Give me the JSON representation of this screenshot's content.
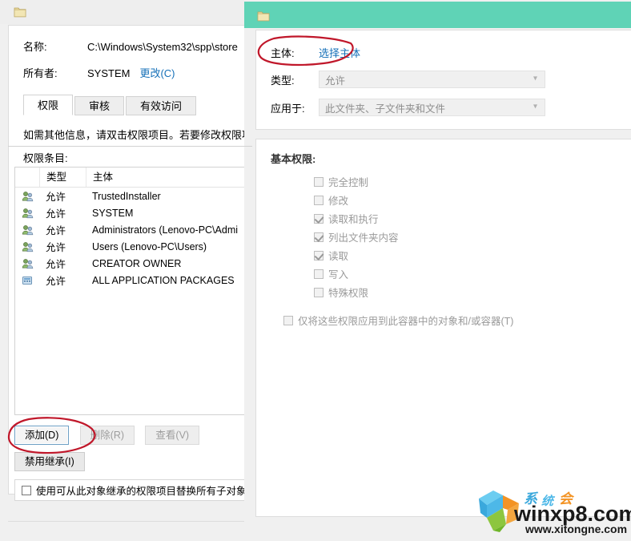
{
  "left_window": {
    "title_icon": "folder-icon",
    "info": {
      "name_label": "名称:",
      "name_value": "C:\\Windows\\System32\\spp\\store",
      "owner_label": "所有者:",
      "owner_value": "SYSTEM",
      "owner_change_link": "更改(C)"
    },
    "tabs": [
      {
        "label": "权限",
        "active": true
      },
      {
        "label": "审核",
        "active": false
      },
      {
        "label": "有效访问",
        "active": false
      }
    ],
    "hint_text": "如需其他信息，请双击权限项目。若要修改权限项",
    "section_label": "权限条目:",
    "table": {
      "columns": [
        "",
        "类型",
        "主体"
      ],
      "rows": [
        {
          "icon": "users-icon",
          "type": "允许",
          "subject": "TrustedInstaller"
        },
        {
          "icon": "users-icon",
          "type": "允许",
          "subject": "SYSTEM"
        },
        {
          "icon": "users-icon",
          "type": "允许",
          "subject": "Administrators (Lenovo-PC\\Admi"
        },
        {
          "icon": "users-icon",
          "type": "允许",
          "subject": "Users (Lenovo-PC\\Users)"
        },
        {
          "icon": "users-icon",
          "type": "允许",
          "subject": "CREATOR OWNER"
        },
        {
          "icon": "app-packages-icon",
          "type": "允许",
          "subject": "ALL APPLICATION PACKAGES"
        }
      ]
    },
    "buttons": {
      "add": "添加(D)",
      "remove": "删除(R)",
      "view": "查看(V)",
      "disable_inheritance": "禁用继承(I)"
    },
    "inherit_checkbox": {
      "label": "使用可从此对象继承的权限项目替换所有子对象",
      "checked": false
    }
  },
  "right_window": {
    "title_icon": "folder-icon",
    "fields": {
      "subject_label": "主体:",
      "subject_link": "选择主体",
      "type_label": "类型:",
      "type_value": "允许",
      "applies_label": "应用于:",
      "applies_value": "此文件夹、子文件夹和文件"
    },
    "basic_permissions_label": "基本权限:",
    "permissions": [
      {
        "label": "完全控制",
        "checked": false
      },
      {
        "label": "修改",
        "checked": false
      },
      {
        "label": "读取和执行",
        "checked": true
      },
      {
        "label": "列出文件夹内容",
        "checked": true
      },
      {
        "label": "读取",
        "checked": true
      },
      {
        "label": "写入",
        "checked": false
      },
      {
        "label": "特殊权限",
        "checked": false
      }
    ],
    "container_only": {
      "label": "仅将这些权限应用到此容器中的对象和/或容器(T)",
      "checked": false
    }
  },
  "annotations": {
    "add_button_circle": "red-ellipse-highlight",
    "subject_row_circle": "red-ellipse-highlight",
    "color": "#c0172a"
  },
  "watermark": {
    "brand": "winxp8.com",
    "url": "www.xitongne.com",
    "chinese": "系统会",
    "logo": "hexagon-star-logo"
  },
  "colors": {
    "titlebar_teal": "#5fd3b6",
    "link_blue": "#1570b8",
    "window_gray": "#f0f0f0",
    "annotation_red": "#c0172a"
  }
}
